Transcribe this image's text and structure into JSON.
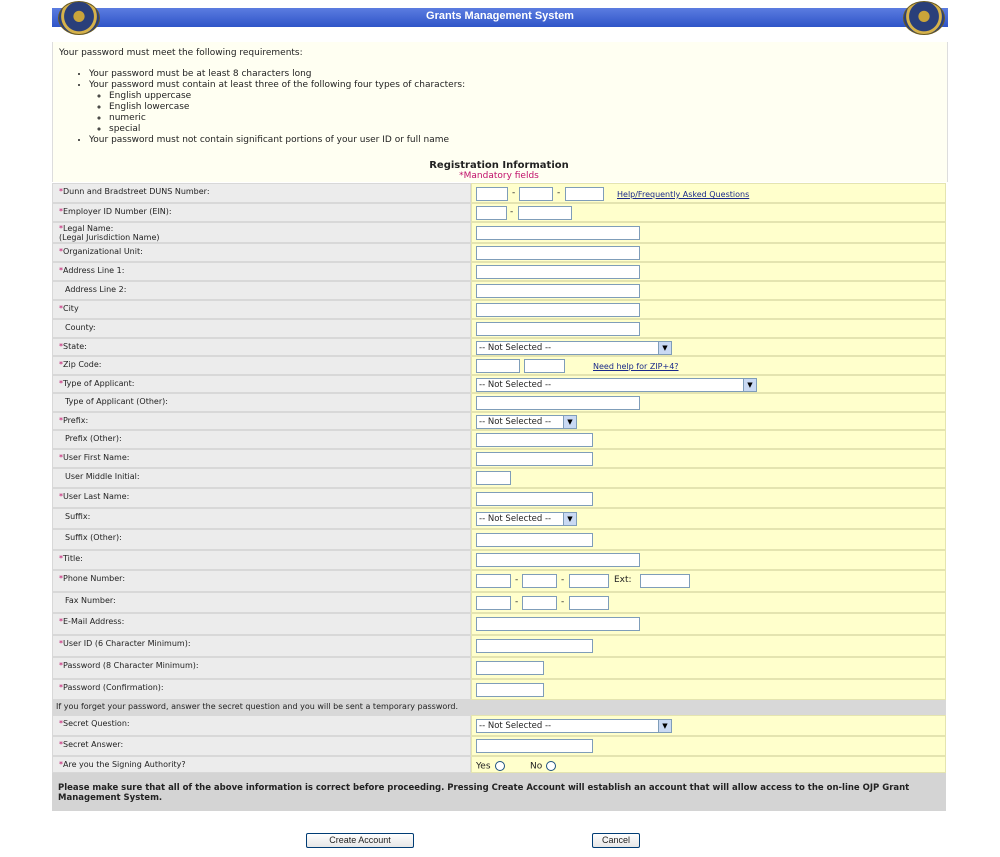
{
  "header": {
    "title": "Grants Management System"
  },
  "requirements": {
    "intro": "Your password must meet the following requirements:",
    "items": [
      "Your password must be at least 8 characters long",
      "Your password must contain at least three of the following four types of characters:",
      "Your password must not contain significant portions of your user ID or full name"
    ],
    "types": [
      "English uppercase",
      "English lowercase",
      "numeric",
      "special"
    ]
  },
  "registration": {
    "title": "Registration Information",
    "mandatory_note": "*Mandatory fields"
  },
  "fields": {
    "duns": "Dunn and Bradstreet DUNS Number:",
    "ein": "Employer ID Number (EIN):",
    "legal_name_1": "Legal Name:",
    "legal_name_2": "(Legal Jurisdiction Name)",
    "org_unit": "Organizational Unit:",
    "addr1": "Address Line 1:",
    "addr2": "Address Line 2:",
    "city": "City",
    "county": "County:",
    "state": "State:",
    "zip": "Zip Code:",
    "type_app": "Type of Applicant:",
    "type_app_other": "Type of Applicant (Other):",
    "prefix": "Prefix:",
    "prefix_other": "Prefix (Other):",
    "first": "User First Name:",
    "middle": "User Middle Initial:",
    "last": "User Last Name:",
    "suffix": "Suffix:",
    "suffix_other": "Suffix (Other):",
    "title": "Title:",
    "phone": "Phone Number:",
    "fax": "Fax Number:",
    "email": "E-Mail Address:",
    "userid": "User ID (6 Character Minimum):",
    "password": "Password (8 Character Minimum):",
    "password_confirm": "Password (Confirmation):",
    "secret_q": "Secret Question:",
    "secret_a": "Secret Answer:",
    "signing": "Are you the Signing Authority?"
  },
  "selects": {
    "not_selected": "-- Not Selected --"
  },
  "links": {
    "faq": "Help/Frequently Asked Questions",
    "zip_help": "Need help for ZIP+4?"
  },
  "labels": {
    "ext": "Ext:",
    "yes": "Yes",
    "no": "No",
    "dash": "-"
  },
  "notices": {
    "forgot": "If you forget your password, answer the secret question and you will be sent a temporary password.",
    "final": "Please make sure that all of the above information is correct before proceeding. Pressing Create Account will establish an account that will allow access to the on-line OJP Grant Management System."
  },
  "buttons": {
    "create": "Create Account",
    "cancel": "Cancel"
  },
  "colors": {
    "header": "#2f55c8",
    "label_bg": "#ececec",
    "value_bg": "#ffffcc",
    "mandatory": "#c0106a"
  }
}
